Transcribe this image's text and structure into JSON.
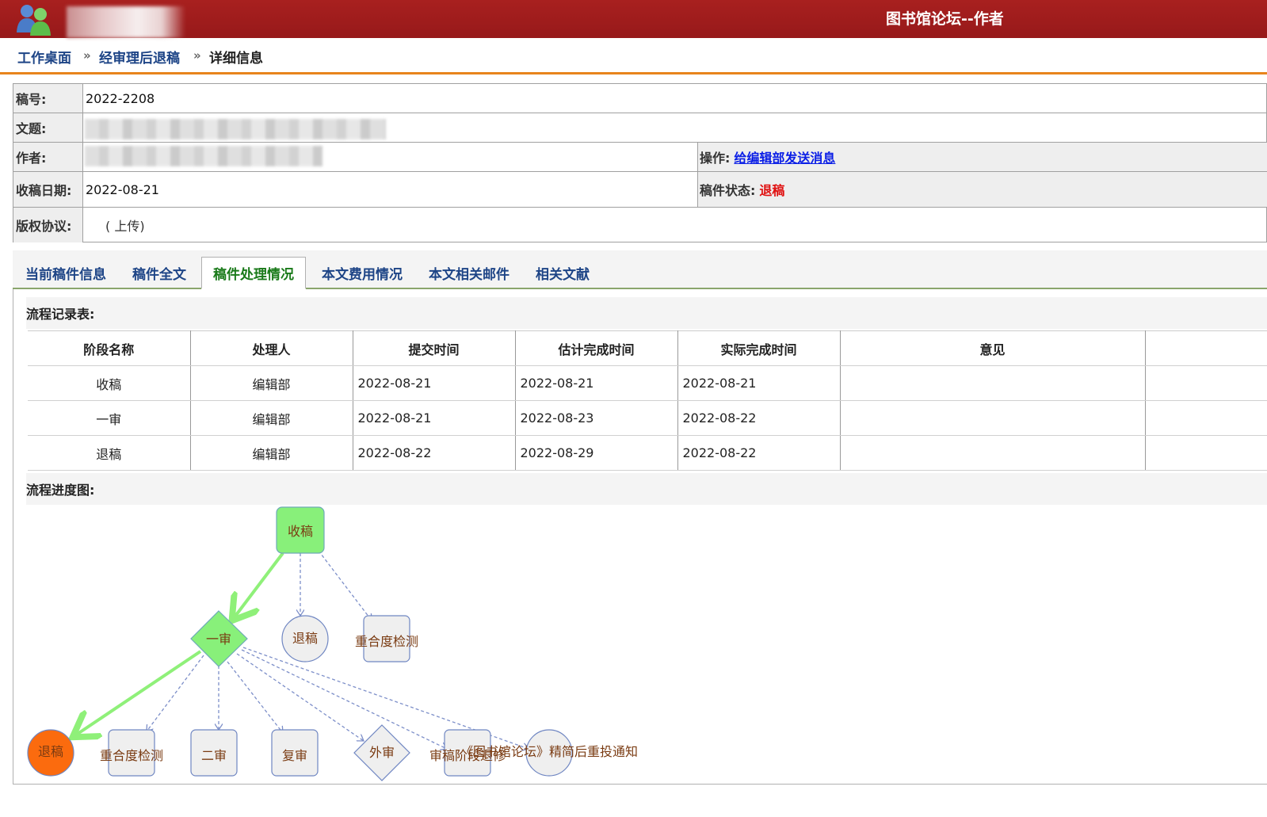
{
  "header": {
    "site_title": "图书馆论坛--作者"
  },
  "breadcrumb": {
    "home": "工作桌面",
    "section": "经审理后退稿",
    "sep": "»",
    "current": "详细信息"
  },
  "info": {
    "number_label": "稿号:",
    "number_value": "2022-2208",
    "title_label": "文题:",
    "author_label": "作者:",
    "action_label": "操作:",
    "action_link": "给编辑部发送消息",
    "date_label": "收稿日期:",
    "date_value": "2022-08-21",
    "status_label": "稿件状态:",
    "status_value": "退稿",
    "copyright_label": "版权协议:",
    "copyright_value": "( 上传)"
  },
  "tabs": [
    "当前稿件信息",
    "稿件全文",
    "稿件处理情况",
    "本文费用情况",
    "本文相关邮件",
    "相关文献"
  ],
  "flow": {
    "record_title": "流程记录表:",
    "columns": [
      "阶段名称",
      "处理人",
      "提交时间",
      "估计完成时间",
      "实际完成时间",
      "意见",
      ""
    ],
    "rows": [
      [
        "收稿",
        "编辑部",
        "2022-08-21",
        "2022-08-21",
        "2022-08-21",
        "",
        ""
      ],
      [
        "一审",
        "编辑部",
        "2022-08-21",
        "2022-08-23",
        "2022-08-22",
        "",
        ""
      ],
      [
        "退稿",
        "编辑部",
        "2022-08-22",
        "2022-08-29",
        "2022-08-22",
        "",
        ""
      ]
    ],
    "chart_title": "流程进度图:"
  },
  "diagram": {
    "top": "收稿",
    "mid": [
      "一审",
      "退稿",
      "重合度检测"
    ],
    "bottom": [
      "退稿",
      "重合度检测",
      "二审",
      "复审",
      "外审",
      "审稿阶段退修",
      "《图书馆论坛》精简后重投通知"
    ],
    "colors": {
      "done": "#88f07a",
      "current": "#fb6b0e",
      "pending": "#efefef",
      "arrow_done": "#8ff079",
      "arrow_todo": "#7d8fc9"
    }
  }
}
